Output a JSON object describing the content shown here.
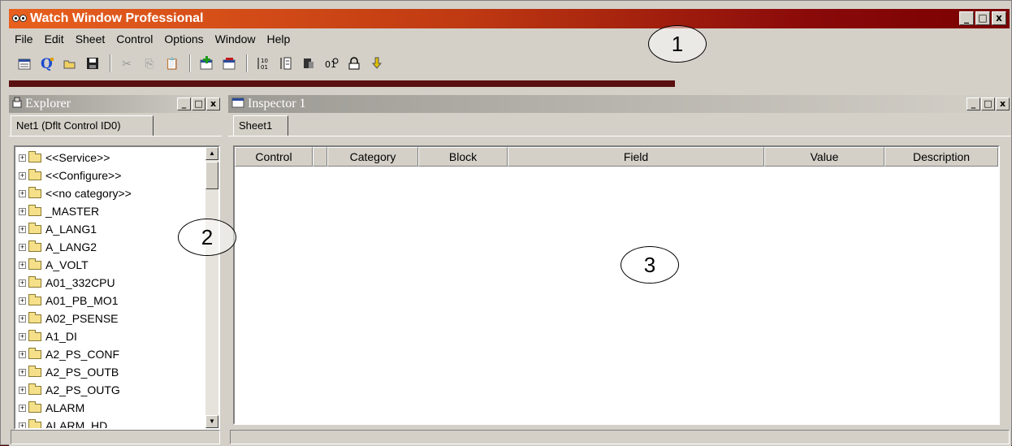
{
  "window": {
    "title": "Watch Window Professional",
    "controls": [
      "_",
      "□",
      "x"
    ]
  },
  "menu": [
    "File",
    "Edit",
    "Sheet",
    "Control",
    "Options",
    "Window",
    "Help"
  ],
  "toolbar": {
    "groups": [
      [
        "new-sheet-icon",
        "connect-icon",
        "open-icon",
        "save-icon"
      ],
      [
        "cut-icon",
        "copy-icon",
        "paste-icon"
      ],
      [
        "add-inspector-icon",
        "remove-inspector-icon"
      ],
      [
        "sort-asc-icon",
        "sort-desc-icon",
        "properties-icon",
        "refresh-icon",
        "lock-icon",
        "download-icon"
      ]
    ]
  },
  "explorer": {
    "title": "Explorer",
    "tab": "Net1 (Dflt Control ID0)",
    "items": [
      "<<Service>>",
      "<<Configure>>",
      "<<no category>>",
      "_MASTER",
      "A_LANG1",
      "A_LANG2",
      "A_VOLT",
      "A01_332CPU",
      "A01_PB_MO1",
      "A02_PSENSE",
      "A1_DI",
      "A2_PS_CONF",
      "A2_PS_OUTB",
      "A2_PS_OUTG",
      "ALARM",
      "ALARM_HD"
    ]
  },
  "inspector": {
    "title": "Inspector 1",
    "tab": "Sheet1",
    "columns": [
      "Control",
      "Category",
      "Block",
      "Field",
      "Value",
      "Description"
    ]
  },
  "callouts": [
    "1",
    "2",
    "3"
  ]
}
